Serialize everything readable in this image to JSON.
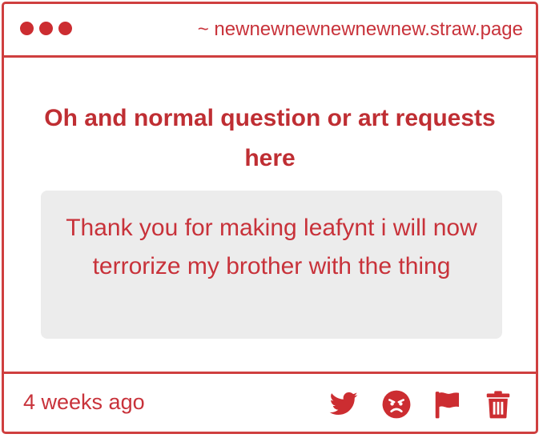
{
  "window": {
    "url": "~ newnewnewnewnewnew.straw.page"
  },
  "question": {
    "text": "Oh and normal question or art requests here"
  },
  "answer": {
    "text": "Thank you for making leafynt i will now terrorize my brother with the thing"
  },
  "footer": {
    "timestamp": "4 weeks ago",
    "icons": [
      "twitter-icon",
      "angry-face-icon",
      "flag-icon",
      "trash-icon"
    ]
  },
  "colors": {
    "accent": "#cc2d31",
    "border": "#cf3f3f",
    "answer_bg": "#ececec"
  }
}
